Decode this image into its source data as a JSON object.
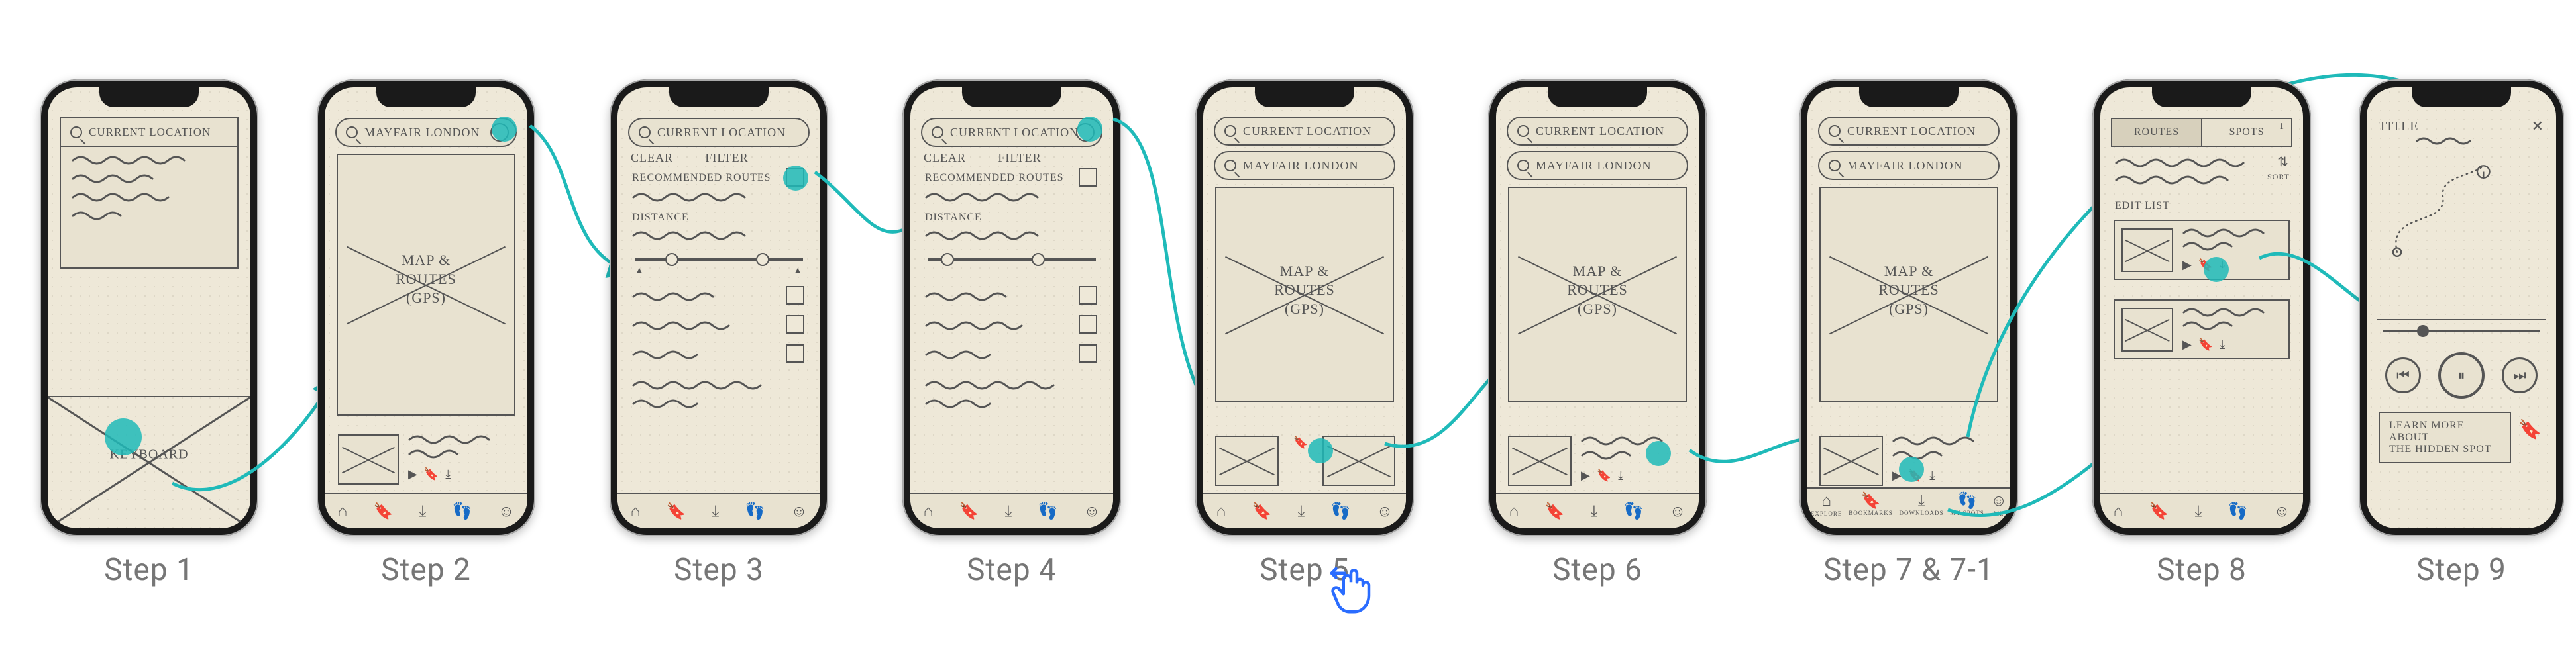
{
  "labels": {
    "step1": "Step 1",
    "step2": "Step 2",
    "step3": "Step 3",
    "step4": "Step 4",
    "step5": "Step 5",
    "step6": "Step 6",
    "step7": "Step 7 & 7-1",
    "step8": "Step 8",
    "step9": "Step 9"
  },
  "step1": {
    "search": "CURRENT LOCATION",
    "keyboard_label": "KEYBOARD"
  },
  "step2": {
    "search": "MAYFAIR  LONDON",
    "map_label": "MAP &\nROUTES\n(GPS)"
  },
  "step3": {
    "search": "Current Location",
    "clear": "clear",
    "filter": "FILTER",
    "section1": "RECOMMENDED ROUTES",
    "section2": "DISTANCE"
  },
  "step4": {
    "search": "Current Location",
    "clear": "clear",
    "filter": "FILTER",
    "section1": "RECOMMENDED ROUTES",
    "section2": "DISTANCE"
  },
  "step5": {
    "search1": "CURRENT LOCATION",
    "search2": "MAYFAIR  LONDON",
    "map_label": "MAP &\nROUTES\n(GPS)"
  },
  "step6": {
    "search1": "CURRENT LOCATION",
    "search2": "MAYFAIR  LONDON",
    "map_label": "MAP &\nROUTES\n(GPS)"
  },
  "step7": {
    "search1": "CURRENT LOCATION",
    "search2": "MAYFAIR  LONDON",
    "map_label": "MAP &\nROUTES\n(GPS)",
    "tabbar": [
      "EXPLORE",
      "BOOKMARKS",
      "DOWNLOADS",
      "MY SPOTS",
      "ME"
    ]
  },
  "step8": {
    "tab_routes": "ROUTES",
    "tab_spots": "SPOTS",
    "badge": "1",
    "sort": "SORT",
    "edit": "EDIT LIST"
  },
  "step9": {
    "title": "TITLE",
    "note": "LEARN MORE ABOUT\nTHE HIDDEN SPOT"
  },
  "accent": {
    "teal": "#1fbab9",
    "blue": "#2a6cff"
  }
}
